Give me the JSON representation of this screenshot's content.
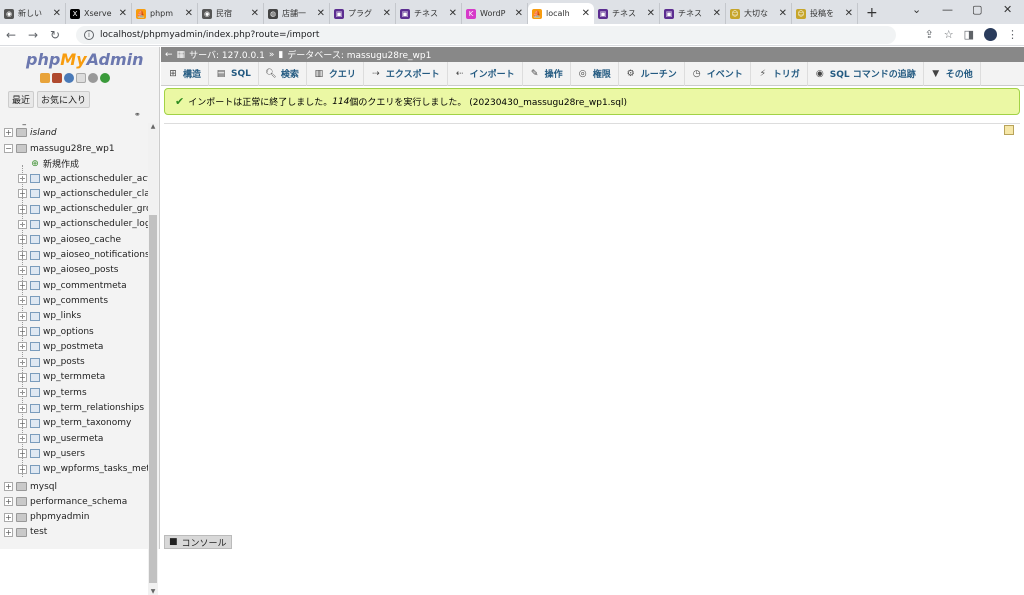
{
  "browser": {
    "tabs": [
      {
        "label": "新しい",
        "icon": "chrome-icon",
        "color": "#555"
      },
      {
        "label": "Xserve",
        "icon": "x-icon",
        "color": "#000"
      },
      {
        "label": "phpm",
        "icon": "phpmyadmin-icon",
        "color": "#f89c0e"
      },
      {
        "label": "民宿",
        "icon": "globe-icon",
        "color": "#555"
      },
      {
        "label": "店舗一",
        "icon": "web-icon",
        "color": "#444"
      },
      {
        "label": "プラグ",
        "icon": "plugin-icon",
        "color": "#5c2d91"
      },
      {
        "label": "チネス",
        "icon": "plugin-icon",
        "color": "#5c2d91"
      },
      {
        "label": "WordP",
        "icon": "kinsta-icon",
        "color": "#d63ac9"
      },
      {
        "label": "localh",
        "icon": "phpmyadmin-icon",
        "color": "#f89c0e"
      },
      {
        "label": "チネス",
        "icon": "plugin-icon",
        "color": "#5c2d91"
      },
      {
        "label": "チネス",
        "icon": "plugin-icon",
        "color": "#5c2d91"
      },
      {
        "label": "大切な",
        "icon": "person-icon",
        "color": "#c6a52a"
      },
      {
        "label": "投稿を",
        "icon": "person-icon",
        "color": "#c6a52a"
      }
    ],
    "active_tab": 8,
    "url": "localhost/phpmyadmin/index.php?route=/import"
  },
  "sidebar": {
    "logo_php": "php",
    "logo_my": "My",
    "logo_admin": "Admin",
    "tab_recent": "最近",
    "tab_favorites": "お気に入り",
    "databases": [
      {
        "name": "island",
        "expanded": false
      },
      {
        "name": "massugu28re_wp1",
        "expanded": true
      }
    ],
    "new_label": "新規作成",
    "tables": [
      "wp_actionscheduler_act",
      "wp_actionscheduler_clai",
      "wp_actionscheduler_gro",
      "wp_actionscheduler_log",
      "wp_aioseo_cache",
      "wp_aioseo_notifications",
      "wp_aioseo_posts",
      "wp_commentmeta",
      "wp_comments",
      "wp_links",
      "wp_options",
      "wp_postmeta",
      "wp_posts",
      "wp_termmeta",
      "wp_terms",
      "wp_term_relationships",
      "wp_term_taxonomy",
      "wp_usermeta",
      "wp_users",
      "wp_wpforms_tasks_met"
    ],
    "other_databases": [
      "mysql",
      "performance_schema",
      "phpmyadmin",
      "test"
    ]
  },
  "breadcrumb": {
    "server": "サーバ: 127.0.0.1",
    "database": "データベース: massugu28re_wp1"
  },
  "menu": [
    {
      "label": "構造",
      "icon": "structure-icon"
    },
    {
      "label": "SQL",
      "icon": "sql-icon"
    },
    {
      "label": "検索",
      "icon": "search-icon"
    },
    {
      "label": "クエリ",
      "icon": "query-icon"
    },
    {
      "label": "エクスポート",
      "icon": "export-icon"
    },
    {
      "label": "インポート",
      "icon": "import-icon"
    },
    {
      "label": "操作",
      "icon": "wrench-icon"
    },
    {
      "label": "権限",
      "icon": "privileges-icon"
    },
    {
      "label": "ルーチン",
      "icon": "routines-icon"
    },
    {
      "label": "イベント",
      "icon": "events-icon"
    },
    {
      "label": "トリガ",
      "icon": "triggers-icon"
    },
    {
      "label": "SQL コマンドの追跡",
      "icon": "tracking-icon"
    },
    {
      "label": "その他",
      "icon": "more-icon"
    }
  ],
  "message": {
    "prefix": "インポートは正常に終了しました。",
    "count": "114",
    "suffix": " 個のクエリを実行しました。 (20230430_massugu28re_wp1.sql)"
  },
  "console_label": "コンソール"
}
